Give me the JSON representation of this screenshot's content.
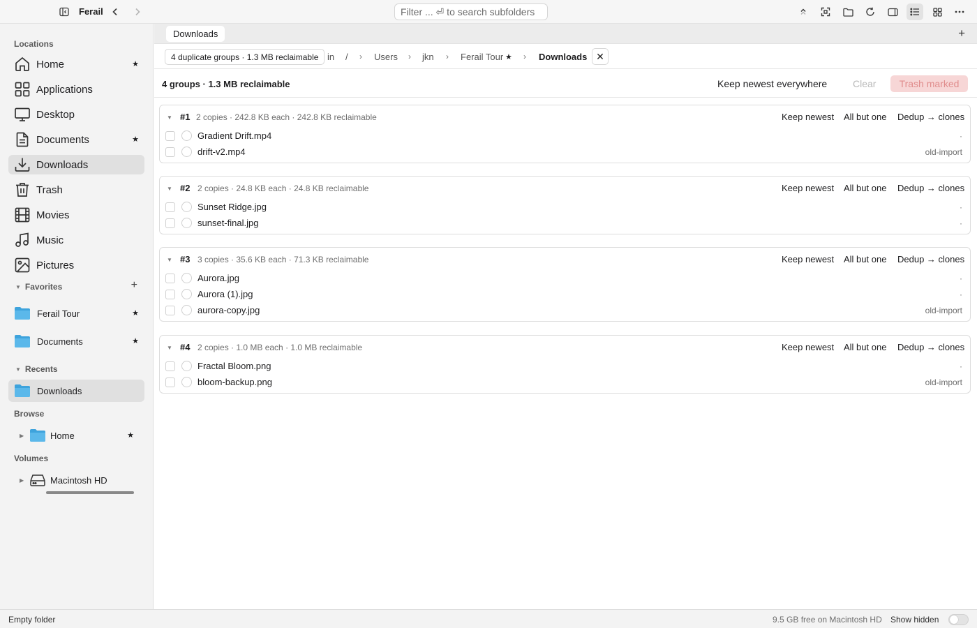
{
  "window": {
    "app_title": "Ferail"
  },
  "toolbar": {
    "filter_placeholder": "Filter ... ⏎ to search subfolders",
    "icons": [
      "sidebar-toggle-icon",
      "back-icon",
      "forward-icon",
      "chevron-up-icon",
      "expand-icon",
      "folder-icon",
      "refresh-icon",
      "panel-icon",
      "list-view-icon",
      "grid-view-icon",
      "more-icon"
    ]
  },
  "sidebar": {
    "locations_header": "Locations",
    "locations": [
      {
        "label": "Home",
        "icon": "home-icon",
        "starred": true
      },
      {
        "label": "Applications",
        "icon": "applications-icon",
        "starred": false
      },
      {
        "label": "Desktop",
        "icon": "desktop-icon",
        "starred": false
      },
      {
        "label": "Documents",
        "icon": "document-icon",
        "starred": true
      },
      {
        "label": "Downloads",
        "icon": "download-icon",
        "starred": false,
        "selected": true
      },
      {
        "label": "Trash",
        "icon": "trash-icon",
        "starred": false
      },
      {
        "label": "Movies",
        "icon": "film-icon",
        "starred": false
      },
      {
        "label": "Music",
        "icon": "music-icon",
        "starred": false
      },
      {
        "label": "Pictures",
        "icon": "picture-icon",
        "starred": false
      }
    ],
    "favorites_header": "Favorites",
    "favorites": [
      {
        "label": "Ferail Tour",
        "starred": true
      },
      {
        "label": "Documents",
        "starred": true
      }
    ],
    "recents_header": "Recents",
    "recents": [
      {
        "label": "Downloads",
        "selected": true
      }
    ],
    "browse_header": "Browse",
    "browse": [
      {
        "label": "Home",
        "starred": true
      }
    ],
    "volumes_header": "Volumes",
    "volumes": [
      {
        "label": "Macintosh HD"
      }
    ],
    "star_glyph": "★",
    "add_glyph": "+"
  },
  "tabs": [
    {
      "label": "Downloads"
    }
  ],
  "tab_add": "+",
  "breadcrumb": {
    "dup_pill": "4 duplicate groups · 1.3 MB reclaimable",
    "in_label": "in",
    "root": "/",
    "separator": "›",
    "parts": [
      "Users",
      "jkn",
      "Ferail Tour"
    ],
    "fav_star": "★",
    "current": "Downloads",
    "close": "✕"
  },
  "summary": {
    "text": "4 groups · 1.3 MB reclaimable",
    "keep_all": "Keep newest everywhere",
    "clear": "Clear",
    "trash": "Trash marked"
  },
  "group_actions": {
    "keep_newest": "Keep newest",
    "all_but_one": "All but one",
    "dedup": "Dedup → clones"
  },
  "groups": [
    {
      "num": "#1",
      "info": "2 copies · 242.8 KB each · 242.8 KB reclaimable",
      "files": [
        {
          "name": "Gradient Drift.mp4",
          "tag": "·"
        },
        {
          "name": "drift-v2.mp4",
          "tag": "old-import"
        }
      ]
    },
    {
      "num": "#2",
      "info": "2 copies · 24.8 KB each · 24.8 KB reclaimable",
      "files": [
        {
          "name": "Sunset Ridge.jpg",
          "tag": "·"
        },
        {
          "name": "sunset-final.jpg",
          "tag": "·"
        }
      ]
    },
    {
      "num": "#3",
      "info": "3 copies · 35.6 KB each · 71.3 KB reclaimable",
      "files": [
        {
          "name": "Aurora.jpg",
          "tag": "·"
        },
        {
          "name": "Aurora (1).jpg",
          "tag": "·"
        },
        {
          "name": "aurora-copy.jpg",
          "tag": "old-import"
        }
      ]
    },
    {
      "num": "#4",
      "info": "2 copies · 1.0 MB each · 1.0 MB reclaimable",
      "files": [
        {
          "name": "Fractal Bloom.png",
          "tag": "·"
        },
        {
          "name": "bloom-backup.png",
          "tag": "old-import"
        }
      ]
    }
  ],
  "status": {
    "left": "Empty folder",
    "free": "9.5 GB free on Macintosh HD",
    "show_hidden": "Show hidden",
    "show_hidden_on": false
  },
  "colors": {
    "accent_trash_bg": "#f7d6d6",
    "accent_trash_fg": "#e08c8c",
    "folder_blue": "#5bb8ea",
    "selected_bg": "#e0e0e0"
  }
}
